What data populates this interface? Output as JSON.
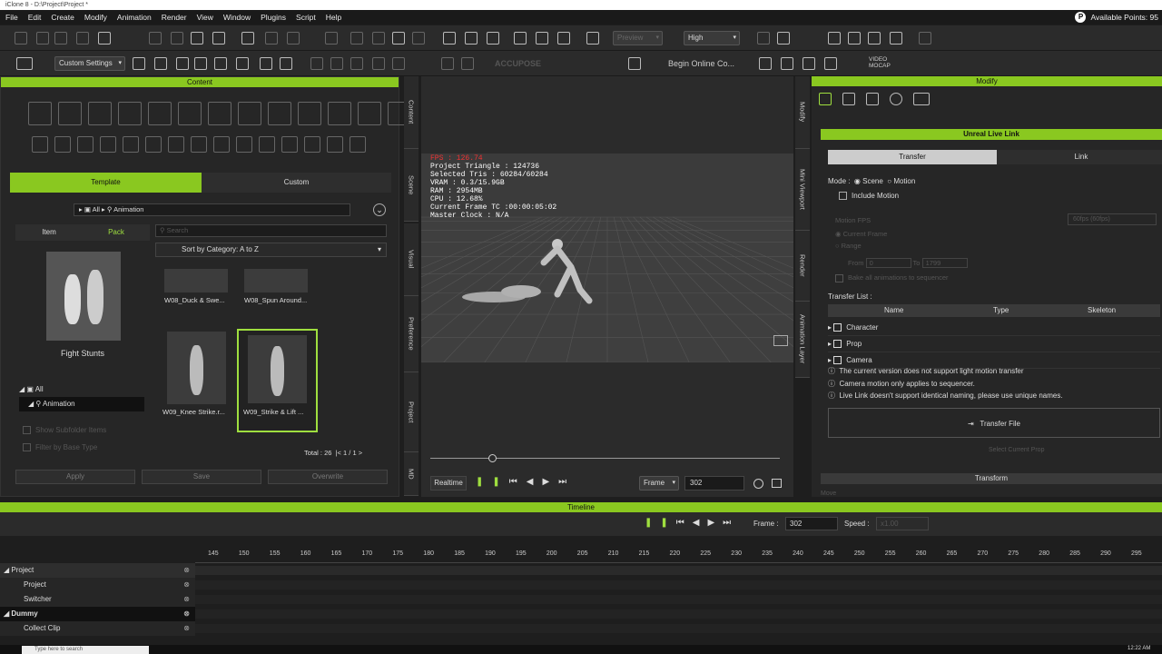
{
  "title_bar": {
    "text": "iClone 8 - D:\\Project\\Project *"
  },
  "menu": [
    "File",
    "Edit",
    "Create",
    "Modify",
    "Animation",
    "Render",
    "View",
    "Window",
    "Plugins",
    "Script",
    "Help"
  ],
  "available_points": "Available Points: 95",
  "toolbar": {
    "quality": "High",
    "preview": "Preview",
    "custom_settings": "Custom Settings",
    "accupose": "ACCUPOSE",
    "search_online": "Begin Online Co...",
    "video_mocap": "VIDEO MOCAP"
  },
  "content": {
    "header": "Content",
    "tabs": [
      "Template",
      "Custom"
    ],
    "subtabs": [
      "Item",
      "Pack"
    ],
    "breadcrumb": [
      "All",
      "Animation"
    ],
    "search_placeholder": "Search",
    "search_filter": "All",
    "sort": "Sort by Category: A to Z",
    "pack_label": "Fight Stunts",
    "tree": [
      "All",
      "Animation"
    ],
    "show_subfolder": "Show Subfolder Items",
    "filter_base": "Filter by Base Type",
    "items": [
      "W08_Duck & Swe...",
      "W08_Spun Around...",
      "W09_Knee Strike.r...",
      "W09_Strike & Lift ..."
    ],
    "total": "Total : 26",
    "page": "1",
    "pages": "1",
    "buttons": [
      "Apply",
      "Save",
      "Overwrite"
    ]
  },
  "sidetabs": [
    "Content",
    "Scene",
    "Visual",
    "Preference",
    "Project",
    "MD"
  ],
  "rightsidetabs": [
    "Modify",
    "Mini Viewport",
    "Render",
    "Animation Layer"
  ],
  "viewport": {
    "fps": "FPS : 126.74",
    "hud": [
      "Project Triangle : 124736",
      "Selected Tris : 60284/60284",
      "VRAM : 0.3/15.9GB",
      "RAM : 2954MB",
      "CPU : 12.68%",
      "Current Frame TC :00:00:05:02",
      "Master Clock : N/A"
    ],
    "playback_mode": "Realtime",
    "frame_mode": "Frame",
    "frame": "302"
  },
  "modify": {
    "header": "Modify",
    "panel_title": "Unreal Live Link",
    "tabs": [
      "Transfer",
      "Link"
    ],
    "mode_label": "Mode :",
    "mode_options": [
      "Scene",
      "Motion"
    ],
    "include_motion": "Include Motion",
    "motion_fps": "Motion FPS",
    "fps_value": "60fps (60fps)",
    "current_frame": "Current Frame",
    "range": "Range",
    "from": "From",
    "from_val": "0",
    "to": "To",
    "to_val": "1799",
    "bake": "Bake all animations to sequencer",
    "transfer_list": "Transfer List :",
    "columns": [
      "Name",
      "Type",
      "Skeleton"
    ],
    "rows": [
      "Character",
      "Prop",
      "Camera"
    ],
    "notes": [
      "The current version does not support light motion transfer",
      "Camera motion only applies to sequencer.",
      "Live Link doesn't support identical naming, please use unique names."
    ],
    "transfer_button": "Transfer File",
    "select_current": "Select Current Prop",
    "transform": "Transform",
    "more": "Move"
  },
  "timeline": {
    "header": "Timeline",
    "frame_label": "Frame :",
    "frame": "302",
    "speed_label": "Speed :",
    "speed": "x1.00",
    "ticks": [
      "145",
      "150",
      "155",
      "160",
      "165",
      "170",
      "175",
      "180",
      "185",
      "190",
      "195",
      "200",
      "205",
      "210",
      "215",
      "220",
      "225",
      "230",
      "235",
      "240",
      "245",
      "250",
      "255",
      "260",
      "265",
      "270",
      "275",
      "280",
      "285",
      "290",
      "295"
    ],
    "tracks": [
      "Project",
      "Project",
      "Switcher",
      "Dummy",
      "Collect Clip"
    ]
  },
  "taskbar": {
    "search": "Type here to search",
    "clock": "12:22 AM"
  }
}
